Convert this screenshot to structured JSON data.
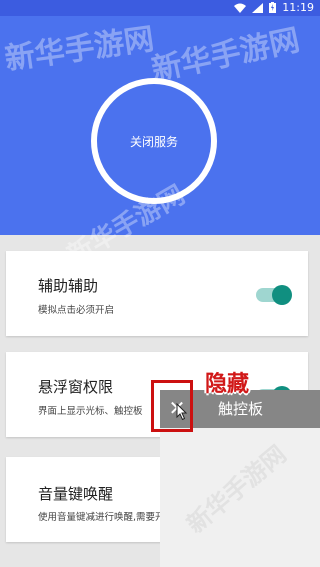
{
  "status_bar": {
    "time": "11:19"
  },
  "header": {
    "service_button_label": "关闭服务"
  },
  "cards": [
    {
      "title": "辅助辅助",
      "desc": "模拟点击必须开启",
      "toggle_on": true
    },
    {
      "title": "悬浮窗权限",
      "desc": "界面上显示光标、触控板",
      "toggle_on": true
    },
    {
      "title": "音量键唤醒",
      "desc": "使用音量键减进行唤醒,需要开启无障碍",
      "toggle_on": false
    }
  ],
  "overlay": {
    "close_symbol": "✕",
    "touchpad_label": "触控板",
    "hide_annotation": "隐藏"
  },
  "watermark": {
    "text": "新华手游网"
  },
  "colors": {
    "header_blue": "#4b72ee",
    "status_blue": "#3c5ce0",
    "toggle_teal": "#108f80",
    "annotation_red": "#d11818"
  },
  "icons": [
    "wifi-icon",
    "signal-icon",
    "battery-icon",
    "cursor-icon",
    "close-icon"
  ]
}
